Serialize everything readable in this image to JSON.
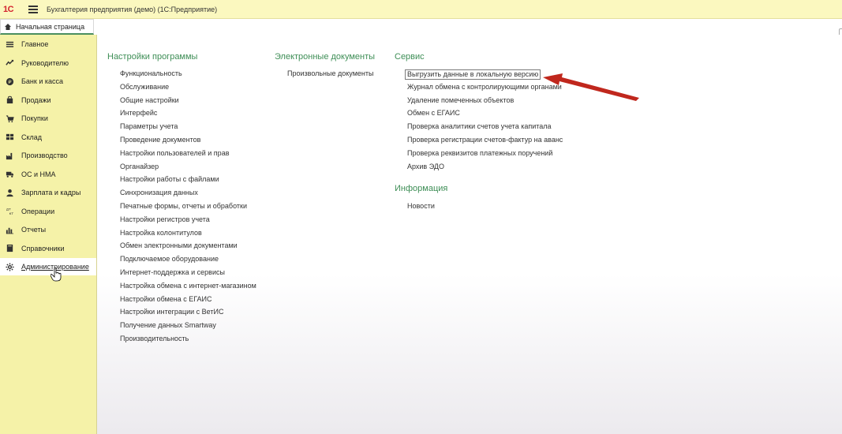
{
  "titlebar": {
    "logo": "1С",
    "title": "Бухгалтерия предприятия (демо)  (1С:Предприятие)"
  },
  "tabs": {
    "home": "Начальная страница"
  },
  "sidebar": {
    "items": [
      {
        "label": "Главное",
        "icon": "menu-lines-icon"
      },
      {
        "label": "Руководителю",
        "icon": "trend-icon"
      },
      {
        "label": "Банк и касса",
        "icon": "coin-icon"
      },
      {
        "label": "Продажи",
        "icon": "bag-icon"
      },
      {
        "label": "Покупки",
        "icon": "cart-icon"
      },
      {
        "label": "Склад",
        "icon": "grid-icon"
      },
      {
        "label": "Производство",
        "icon": "factory-icon"
      },
      {
        "label": "ОС и НМА",
        "icon": "truck-icon"
      },
      {
        "label": "Зарплата и кадры",
        "icon": "person-icon"
      },
      {
        "label": "Операции",
        "icon": "dt-kt-icon"
      },
      {
        "label": "Отчеты",
        "icon": "bars-icon"
      },
      {
        "label": "Справочники",
        "icon": "book-icon"
      },
      {
        "label": "Администрирование",
        "icon": "gear-icon",
        "active": true
      }
    ]
  },
  "main": {
    "settings": {
      "heading": "Настройки программы",
      "links": [
        "Функциональность",
        "Обслуживание",
        "Общие настройки",
        "Интерфейс",
        "Параметры учета",
        "Проведение документов",
        "Настройки пользователей и прав",
        "Органайзер",
        "Настройки работы с файлами",
        "Синхронизация данных",
        "Печатные формы, отчеты и обработки",
        "Настройки регистров учета",
        "Настройка колонтитулов",
        "Обмен электронными документами",
        "Подключаемое оборудование",
        "Интернет-поддержка и сервисы",
        "Настройка обмена с интернет-магазином",
        "Настройки обмена с ЕГАИС",
        "Настройки интеграции с ВетИС",
        "Получение данных Smartway",
        "Производительность"
      ]
    },
    "edocs": {
      "heading": "Электронные документы",
      "links": [
        "Произвольные документы"
      ]
    },
    "service": {
      "heading": "Сервис",
      "links": [
        "Выгрузить данные в локальную версию",
        "Журнал обмена с контролирующими органами",
        "Удаление помеченных объектов",
        "Обмен с ЕГАИС",
        "Проверка аналитики счетов учета капитала",
        "Проверка регистрации счетов-фактур на аванс",
        "Проверка реквизитов платежных поручений",
        "Архив ЭДО"
      ]
    },
    "info": {
      "heading": "Информация",
      "links": [
        "Новости"
      ]
    }
  },
  "colors": {
    "titlebar_bg": "#fbf8bf",
    "sidebar_bg": "#f5f2a8",
    "heading_green": "#3e8e56",
    "arrow_red": "#c0271d",
    "logo_red": "#d3232e"
  }
}
